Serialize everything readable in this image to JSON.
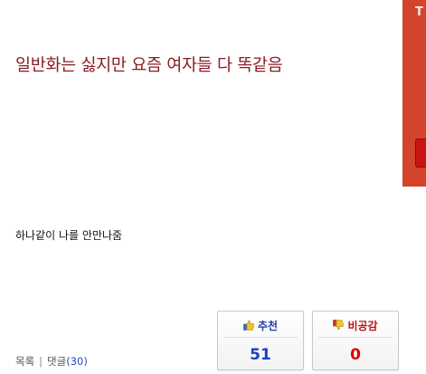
{
  "post": {
    "title": "일반화는 싫지만 요즘 여자들 다 똑같음",
    "body": "하나같이 나를 안만나줌"
  },
  "ad": {
    "text": "T"
  },
  "votes": {
    "recommend": {
      "label": "추천",
      "count": "51",
      "icon": "thumbs-up-icon",
      "color": "#1a3fcc"
    },
    "disapprove": {
      "label": "비공감",
      "count": "0",
      "icon": "thumbs-down-icon",
      "color": "#e00000"
    }
  },
  "footer": {
    "list_label": "목록",
    "separator": "|",
    "comments_label": "댓글",
    "comments_count": "(30)"
  },
  "colors": {
    "title": "#8b1c24",
    "ad_background": "#d4432c"
  }
}
